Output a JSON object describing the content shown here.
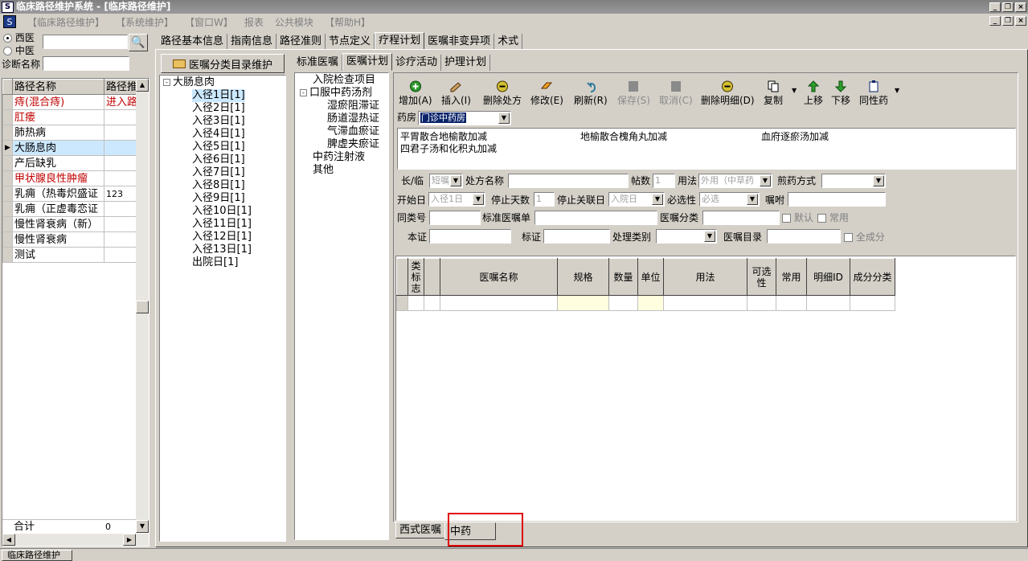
{
  "window": {
    "title": "临床路径维护系统 - [临床路径维护]",
    "app_icon": "S"
  },
  "menu": [
    "【临床路径维护】",
    "【系统维护】",
    "【窗口W】",
    "报表",
    "公共模块",
    "【帮助H】"
  ],
  "left": {
    "radio_western": "西医",
    "radio_chinese": "中医",
    "diagnosis_label": "诊断名称",
    "search_value": "",
    "diagnosis_value": "",
    "columns": [
      "路径名称",
      "路径推"
    ],
    "rows": [
      {
        "name": "痔(混合痔)",
        "status": "进入路",
        "red": true
      },
      {
        "name": "肛瘘",
        "status": "",
        "red": true
      },
      {
        "name": "肺热病",
        "status": "",
        "red": false
      },
      {
        "name": "大肠息肉",
        "status": "",
        "red": false,
        "selected": true
      },
      {
        "name": "产后缺乳",
        "status": "",
        "red": false
      },
      {
        "name": "甲状腺良性肿瘤",
        "status": "",
        "red": true
      },
      {
        "name": "乳痈（热毒炽盛证",
        "status": "123",
        "red": false
      },
      {
        "name": "乳痈（正虚毒恋证",
        "status": "",
        "red": false
      },
      {
        "name": "慢性肾衰病（新）",
        "status": "",
        "red": false
      },
      {
        "name": "慢性肾衰病",
        "status": "",
        "red": false
      },
      {
        "name": "测试",
        "status": "",
        "red": false
      }
    ],
    "total_label": "合计",
    "total_value": "0"
  },
  "main_tabs": [
    "路径基本信息",
    "指南信息",
    "路径准则",
    "节点定义",
    "疗程计划",
    "医嘱非变异项",
    "术式"
  ],
  "main_tab_active": 4,
  "catalog_button": "医嘱分类目录维护",
  "path_tree": {
    "root": "大肠息肉",
    "nodes": [
      "入径1日[1]",
      "入径2日[1]",
      "入径3日[1]",
      "入径4日[1]",
      "入径5日[1]",
      "入径6日[1]",
      "入径7日[1]",
      "入径8日[1]",
      "入径9日[1]",
      "入径10日[1]",
      "入径11日[1]",
      "入径12日[1]",
      "入径13日[1]",
      "出院日[1]"
    ]
  },
  "sub_tabs": [
    "标准医嘱",
    "医嘱计划",
    "诊疗活动",
    "护理计划"
  ],
  "sub_tab_active": 1,
  "category_tree": {
    "item1": "入院检查项目",
    "item2": "口服中药汤剂",
    "children": [
      "湿瘀阻滞证",
      "肠道湿热证",
      "气滞血瘀证",
      "脾虚夹瘀证"
    ],
    "item3": "中药注射液",
    "item4": "其他"
  },
  "toolbar": [
    {
      "label": "增加(A)",
      "icon": "plus-circle-icon",
      "enabled": true
    },
    {
      "label": "插入(I)",
      "icon": "insert-icon",
      "enabled": true
    },
    {
      "label": "删除处方",
      "icon": "minus-circle-icon",
      "enabled": true
    },
    {
      "label": "修改(E)",
      "icon": "eraser-icon",
      "enabled": true
    },
    {
      "label": "刷新(R)",
      "icon": "refresh-icon",
      "enabled": true
    },
    {
      "label": "保存(S)",
      "icon": "save-icon",
      "enabled": false
    },
    {
      "label": "取消(C)",
      "icon": "cancel-icon",
      "enabled": false
    },
    {
      "label": "删除明细(D)",
      "icon": "minus-circle-icon",
      "enabled": true
    },
    {
      "label": "复制",
      "icon": "copy-icon",
      "enabled": true
    },
    {
      "label": "上移",
      "icon": "arrow-up-icon",
      "enabled": true
    },
    {
      "label": "下移",
      "icon": "arrow-down-icon",
      "enabled": true
    },
    {
      "label": "同性药",
      "icon": "clipboard-icon",
      "enabled": true
    }
  ],
  "pharmacy": {
    "label": "药房",
    "value": "门诊中药房"
  },
  "recipes": [
    "平胃散合地榆散加减",
    "地榆散合槐角丸加减",
    "血府逐瘀汤加减",
    "四君子汤和化积丸加减"
  ],
  "form": {
    "long_temp_label": "长/临",
    "long_temp_value": "短嘱",
    "recipe_name_label": "处方名称",
    "recipe_name_value": "",
    "doses_label": "帖数",
    "doses_value": "1",
    "usage_label": "用法",
    "usage_value": "外用（中草药",
    "decoct_label": "煎药方式",
    "decoct_value": "",
    "start_label": "开始日",
    "start_value": "入径1日",
    "stop_days_label": "停止天数",
    "stop_days_value": "1",
    "stop_link_label": "停止关联日",
    "stop_link_value": "入院日",
    "required_label": "必选性",
    "required_value": "必选",
    "instruction_label": "嘱咐",
    "instruction_value": "",
    "same_no_label": "同类号",
    "same_no_value": "",
    "std_order_label": "标准医嘱单",
    "std_order_value": "",
    "order_cat_label": "医嘱分类",
    "order_cat_value": "",
    "default_label": "默认",
    "common_label": "常用",
    "syndrome_label": "本证",
    "syndrome_value": "",
    "symptom_label": "标证",
    "symptom_value": "",
    "process_label": "处理类别",
    "process_value": "",
    "order_dir_label": "医嘱目录",
    "order_dir_value": "",
    "all_comp_label": "全成分"
  },
  "grid_columns": [
    "类标志",
    "",
    "医嘱名称",
    "规格",
    "数量",
    "单位",
    "用法",
    "可选性",
    "常用",
    "明细ID",
    "成分分类"
  ],
  "bottom_tabs": [
    "西式医嘱",
    "中药"
  ],
  "bottom_tab_active": 1,
  "status_bar": "临床路径维护"
}
